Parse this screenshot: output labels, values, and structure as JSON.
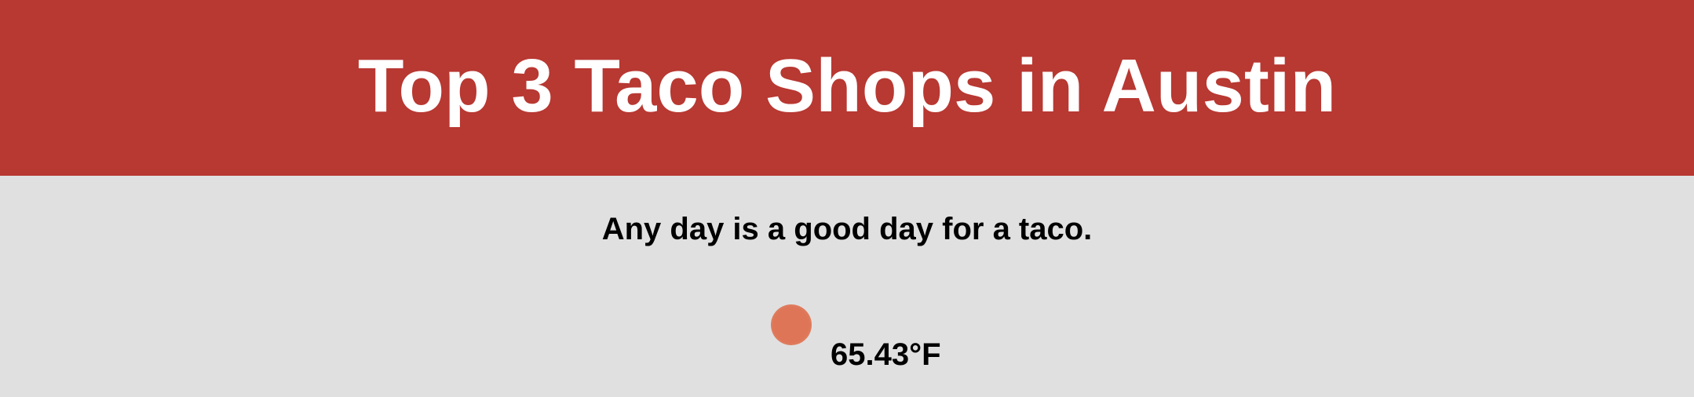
{
  "header": {
    "title": "Top 3 Taco Shops in Austin"
  },
  "main": {
    "tagline": "Any day is a good day for a taco.",
    "weather": {
      "icon": "weather-sun-icon",
      "temperature": "65.43°F"
    }
  },
  "colors": {
    "header_bg": "#b83832",
    "page_bg": "#e0e0e0",
    "icon_color": "#de7556"
  }
}
